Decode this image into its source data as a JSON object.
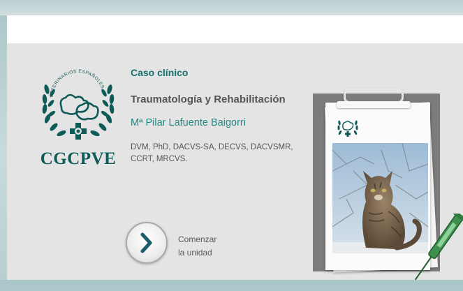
{
  "brand": {
    "name": "CGCPVE",
    "arc_text": "VETERINARIOS ESPAÑOLES"
  },
  "case": {
    "section": "Caso clínico",
    "topic": "Traumatología y Rehabilitación",
    "author": "Mª Pilar Lafuente Baigorri",
    "credentials": "DVM, PhD, DACVS-SA, DECVS, DACVSMR, CCRT, MRCVS."
  },
  "start": {
    "label_line1": "Comenzar",
    "label_line2": "la unidad"
  },
  "icons": {
    "start_button": "chevron-right-icon",
    "logo": "cgcpve-emblem-icon",
    "clipboard": "clipboard-icon",
    "syringe": "syringe-icon"
  },
  "colors": {
    "brand_teal": "#0e5b57",
    "accent_teal": "#1f8a84",
    "panel_gray": "#e4e4e4"
  }
}
